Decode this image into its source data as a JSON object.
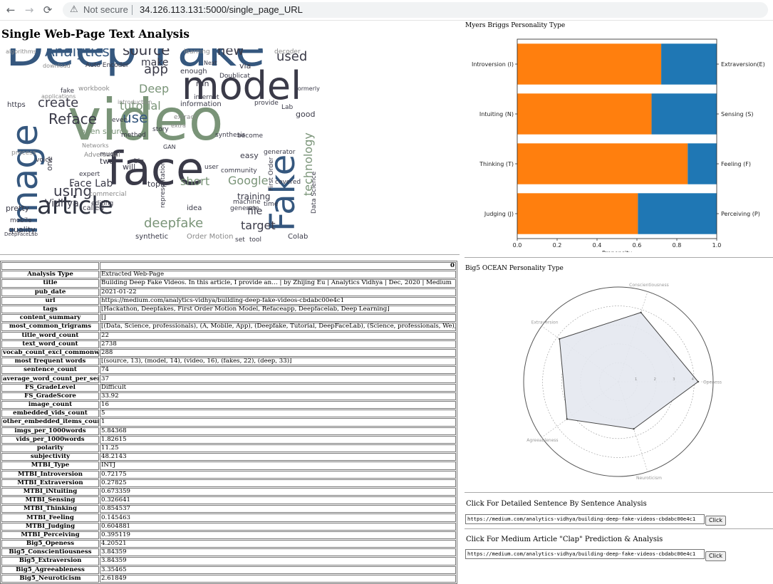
{
  "browser": {
    "back": "←",
    "forward": "→",
    "reload": "⟳",
    "security_icon": "warning-triangle-icon",
    "not_secure": "Not secure",
    "url": "34.126.113.131:5000/single_page_URL"
  },
  "page_title": "Single Web-Page Text Analysis",
  "wordcloud": {
    "words": [
      "Deep Fake",
      "video",
      "face",
      "model",
      "image",
      "Fake",
      "article",
      "Analytics",
      "source",
      "new",
      "used",
      "app",
      "make",
      "create",
      "Reface",
      "use",
      "tutorial",
      "Deep",
      "using",
      "Vidhya",
      "Face Lab",
      "deepfake",
      "target",
      "short",
      "Google",
      "file",
      "technology",
      "topic",
      "training",
      "one",
      "Auto Encoder",
      "algorithms",
      "download",
      "learning",
      "decoder",
      "via",
      "run",
      "enough",
      "GAN",
      "information",
      "https",
      "workbook",
      "Adversarial",
      "open source",
      "method",
      "easy",
      "become",
      "will",
      "two",
      "much",
      "expert",
      "called",
      "pretty",
      "quality",
      "mobile",
      "editing",
      "commercial",
      "synthetic",
      "Order Motion",
      "Colab",
      "idea",
      "machine",
      "generate",
      "time",
      "covered",
      "provide",
      "good",
      "extract",
      "story",
      "voice",
      "process",
      "user",
      "community",
      "First Order",
      "Data Science",
      "representation",
      "big",
      "synthesis",
      "generator",
      "Next",
      "formerly",
      "set",
      "tool",
      "internet",
      "Doublicat",
      "Lab",
      "DeepFaceLab",
      "fake",
      "even",
      "introduction",
      "applications",
      "extra",
      "Networks"
    ]
  },
  "table": {
    "header_index": "",
    "header_value": "0",
    "rows": [
      {
        "k": "Analysis Type",
        "v": "Extracted Web-Page"
      },
      {
        "k": "title",
        "v": "Building Deep Fake Videos. In this article, I provide an… | by Zhijing Eu | Analytics Vidhya | Dec, 2020 | Medium"
      },
      {
        "k": "pub_date",
        "v": "2021-01-22"
      },
      {
        "k": "url",
        "v": "https://medium.com/analytics-vidhya/building-deep-fake-videos-cbdabc00e4c1"
      },
      {
        "k": "tags",
        "v": "[Hackathon, Deepfakes, First Order Motion Model, Refaceapp, Deepfacelab, Deep Learning]"
      },
      {
        "k": "content_summary",
        "v": "[]"
      },
      {
        "k": "most_common_trigrams",
        "v": "[(Data, Science, professionals), (A, Mobile, App), (Deepfake, Tutorial, DeepFaceLab), (Science, professionals, We), (data, science, ecosystem)]"
      },
      {
        "k": "title_word_count",
        "v": "22"
      },
      {
        "k": "text_word_count",
        "v": "2738"
      },
      {
        "k": "vocab_count_excl_commonwords",
        "v": "288"
      },
      {
        "k": "most frequent words",
        "v": "[(source, 13), (model, 14), (video, 16), (fakes, 22), (deep, 33)]"
      },
      {
        "k": "sentence_count",
        "v": "74"
      },
      {
        "k": "average_word_count_per_sentence",
        "v": "37"
      },
      {
        "k": "FS_GradeLevel",
        "v": "Difficult"
      },
      {
        "k": "FS_GradeScore",
        "v": "33.92"
      },
      {
        "k": "image_count",
        "v": "16"
      },
      {
        "k": "embedded_vids_count",
        "v": "5"
      },
      {
        "k": "other_embedded_items_count",
        "v": "1"
      },
      {
        "k": "imgs_per_1000words",
        "v": "5.84368"
      },
      {
        "k": "vids_per_1000words",
        "v": "1.82615"
      },
      {
        "k": "polarity",
        "v": "11.25"
      },
      {
        "k": "subjectivity",
        "v": "48.2143"
      },
      {
        "k": "MTBI_Type",
        "v": "INTJ"
      },
      {
        "k": "MTBI_Introversion",
        "v": "0.72175"
      },
      {
        "k": "MTBI_Extraversion",
        "v": "0.27825"
      },
      {
        "k": "MTBI_iNtuiting",
        "v": "0.673359"
      },
      {
        "k": "MTBI_Sensing",
        "v": "0.326641"
      },
      {
        "k": "MTBI_Thinking",
        "v": "0.854537"
      },
      {
        "k": "MTBI_Feeling",
        "v": "0.145463"
      },
      {
        "k": "MTBI_Judging",
        "v": "0.604881"
      },
      {
        "k": "MTBI_Perceiving",
        "v": "0.395119"
      },
      {
        "k": "Big5_Openess",
        "v": "4.20521"
      },
      {
        "k": "Big5_Conscientiousness",
        "v": "3.84359"
      },
      {
        "k": "Big5_Extraversion",
        "v": "3.84359"
      },
      {
        "k": "Big5_Agreeableness",
        "v": "3.35465"
      },
      {
        "k": "Big5_Neuroticism",
        "v": "2.61849"
      }
    ]
  },
  "mbti_chart_title": "Myers Briggs Personality Type",
  "big5_chart_title": "Big5 OCEAN Personality Type",
  "chart_data": [
    {
      "type": "bar",
      "orientation": "horizontal-stacked",
      "categories_left": [
        "Introversion (I)",
        "Intuiting (N)",
        "Thinking (T)",
        "Judging (J)"
      ],
      "categories_right": [
        "Extraversion(E)",
        "Sensing (S)",
        "Feeling (F)",
        "Perceiving (P)"
      ],
      "series": [
        {
          "values": [
            0.72175,
            0.673359,
            0.854537,
            0.604881
          ],
          "color": "#ff7f0e"
        },
        {
          "values": [
            0.27825,
            0.326641,
            0.145463,
            0.395119
          ],
          "color": "#1f77b4"
        }
      ],
      "xlabel": "Propensity",
      "xlim": [
        0,
        1.0
      ],
      "xticks": [
        "0.0",
        "0.2",
        "0.4",
        "0.6",
        "0.8",
        "1.0"
      ],
      "grid": false
    },
    {
      "type": "radar",
      "axes": [
        "Openess",
        "Conscientiousness",
        "Extraversion",
        "Agreeableness",
        "Neuroticism"
      ],
      "values": [
        4.20521,
        3.84359,
        3.84359,
        3.35465,
        2.61849
      ],
      "rmax": 5,
      "rticks": [
        "1",
        "2",
        "3",
        "4"
      ],
      "fill": "#e4e8f0",
      "stroke": "#444444",
      "grid": true
    }
  ],
  "detail": {
    "label": "Click For Detailed Sentence By Sentence Analysis",
    "url_value": "https://medium.com/analytics-vidhya/building-deep-fake-videos-cbdabc00e4c1",
    "button": "Click"
  },
  "clap": {
    "label": "Click For Medium Article \"Clap\" Prediction & Analysis",
    "url_value": "https://medium.com/analytics-vidhya/building-deep-fake-videos-cbdabc00e4c1",
    "button": "Click"
  }
}
